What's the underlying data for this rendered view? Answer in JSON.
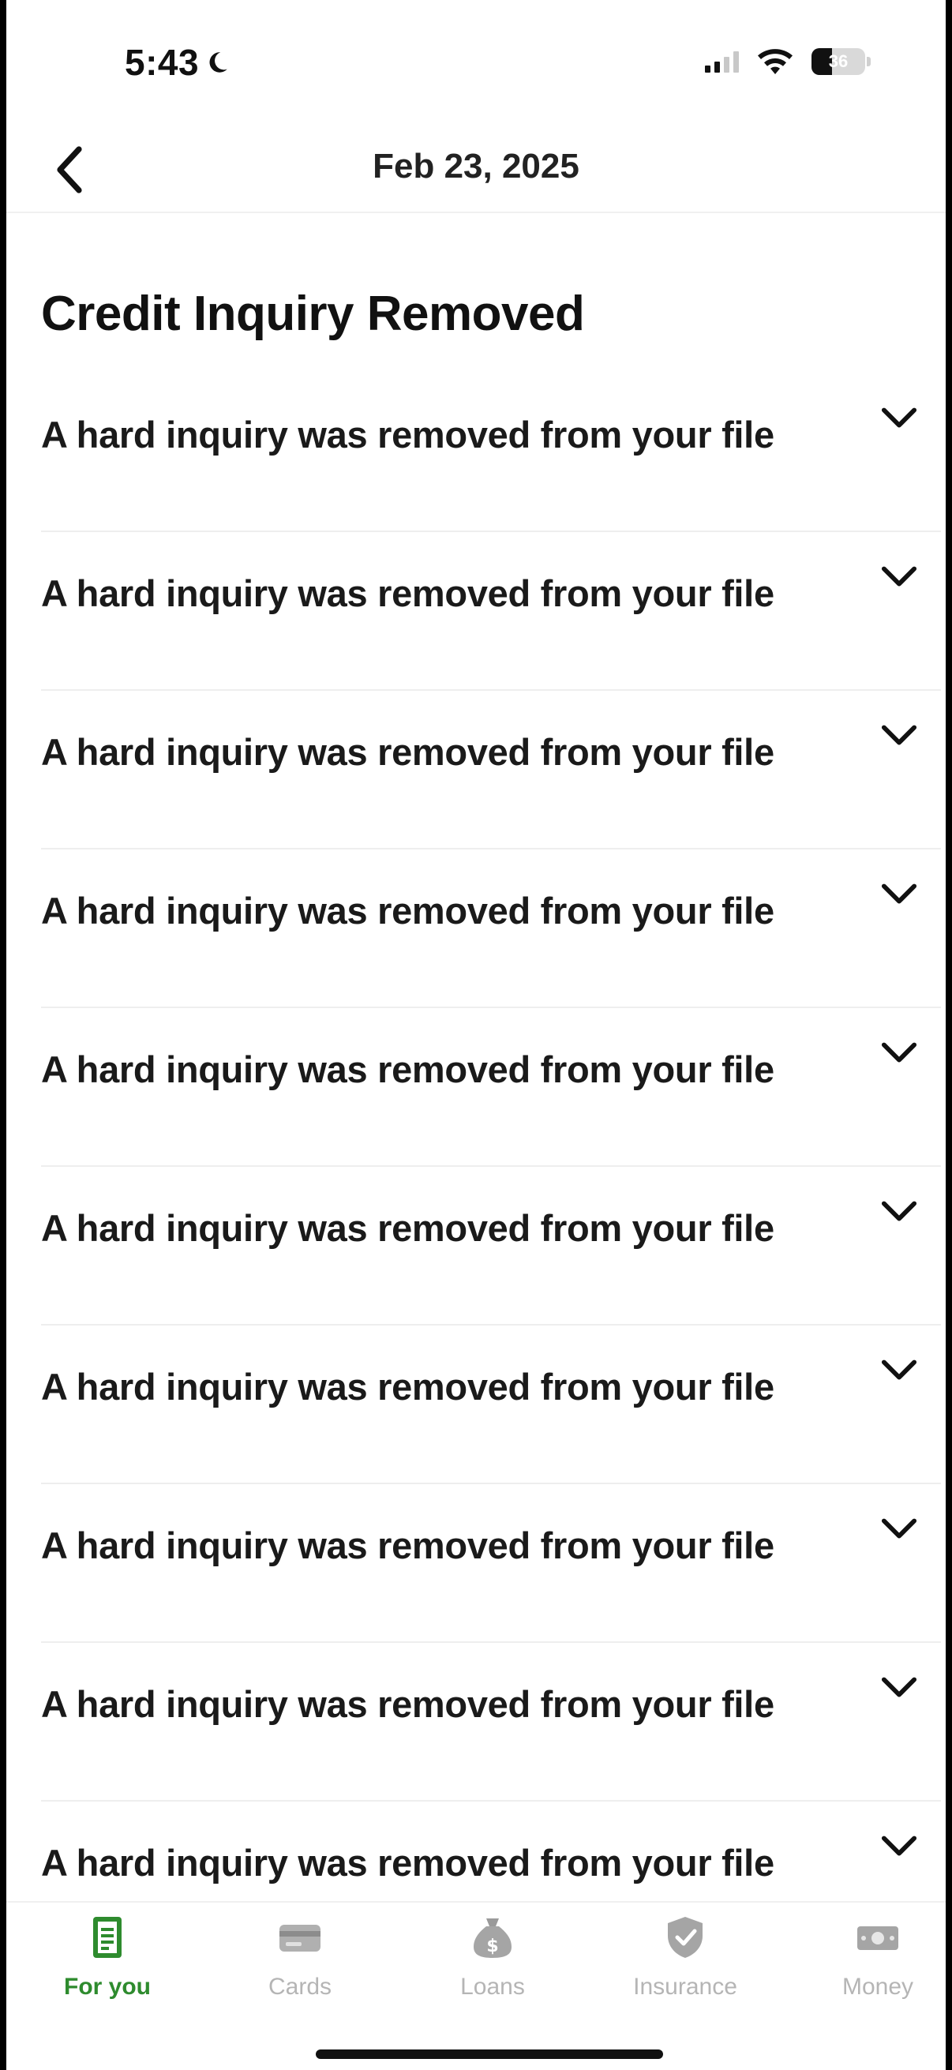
{
  "status_bar": {
    "time": "5:43",
    "battery": "36"
  },
  "header": {
    "title": "Feb 23, 2025"
  },
  "main": {
    "title": "Credit Inquiry Removed",
    "items": [
      {
        "text": "A hard inquiry was removed from your file"
      },
      {
        "text": "A hard inquiry was removed from your file"
      },
      {
        "text": "A hard inquiry was removed from your file"
      },
      {
        "text": "A hard inquiry was removed from your file"
      },
      {
        "text": "A hard inquiry was removed from your file"
      },
      {
        "text": "A hard inquiry was removed from your file"
      },
      {
        "text": "A hard inquiry was removed from your file"
      },
      {
        "text": "A hard inquiry was removed from your file"
      },
      {
        "text": "A hard inquiry was removed from your file"
      },
      {
        "text": "A hard inquiry was removed from your file"
      }
    ]
  },
  "tab_bar": {
    "tabs": [
      {
        "label": "For you",
        "icon": "document-icon",
        "active": true
      },
      {
        "label": "Cards",
        "icon": "card-icon",
        "active": false
      },
      {
        "label": "Loans",
        "icon": "money-bag-icon",
        "active": false
      },
      {
        "label": "Insurance",
        "icon": "shield-icon",
        "active": false
      },
      {
        "label": "Money",
        "icon": "cash-icon",
        "active": false
      }
    ]
  },
  "colors": {
    "accent": "#2e8b2e",
    "inactive_tab": "#b5b5b5",
    "text": "#111111"
  }
}
